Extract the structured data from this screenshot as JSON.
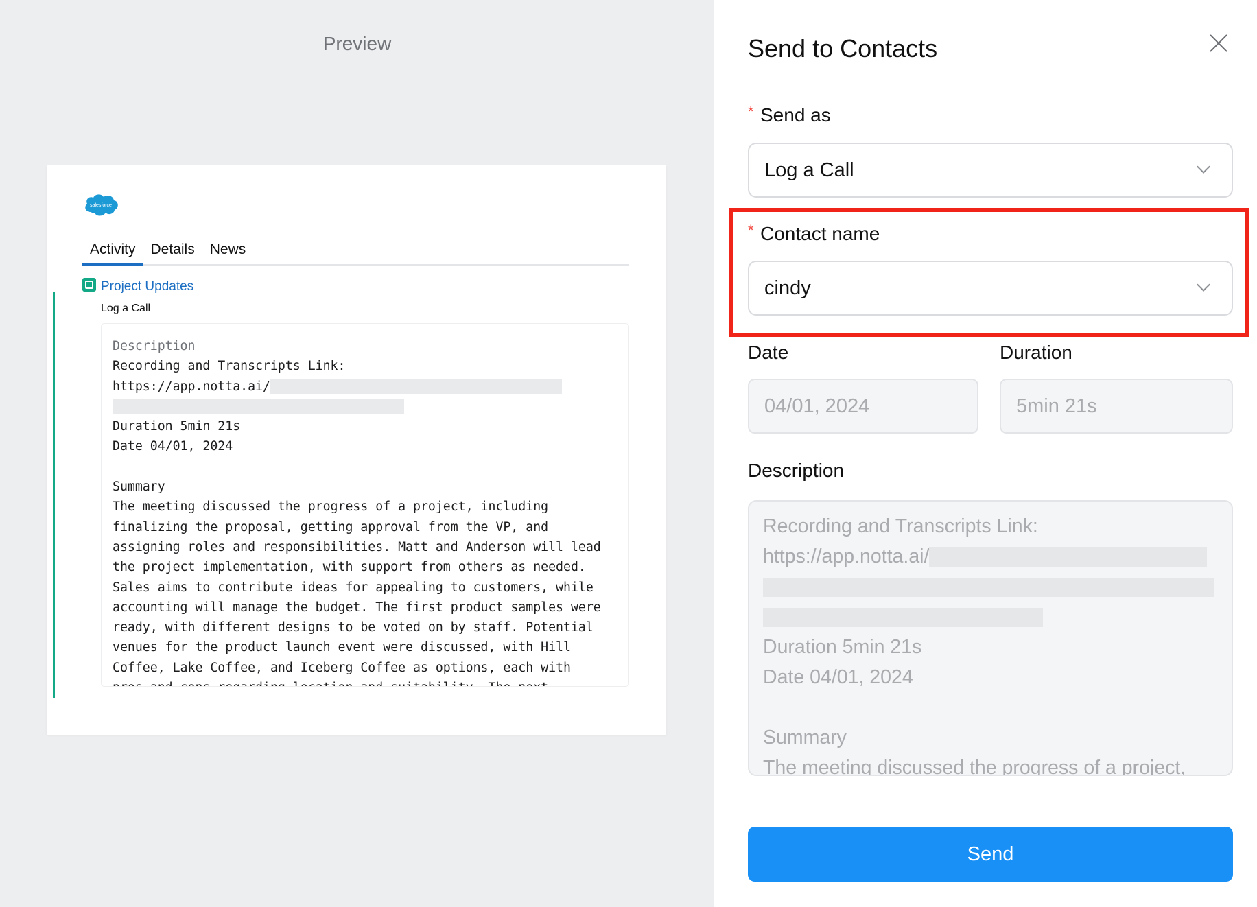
{
  "preview": {
    "title": "Preview",
    "tabs": [
      "Activity",
      "Details",
      "News"
    ],
    "activity": {
      "link": "Project Updates",
      "subtitle": "Log a Call",
      "description_label": "Description",
      "line1": "Recording and Transcripts Link:",
      "line2": "https://app.notta.ai/",
      "duration": "Duration 5min 21s",
      "date": "Date 04/01, 2024",
      "summary_label": "Summary",
      "summary": "The meeting discussed the progress of a project, including\nfinalizing the proposal, getting approval from the VP, and\nassigning roles and responsibilities. Matt and Anderson will lead\nthe project implementation, with support from others as needed.\nSales aims to contribute ideas for appealing to customers, while\naccounting will manage the budget. The first product samples were\nready, with different designs to be voted on by staff. Potential\nvenues for the product launch event were discussed, with Hill\nCoffee, Lake Coffee, and Iceberg Coffee as options, each with\npros and cons regarding location and suitability. The next"
    }
  },
  "panel": {
    "title": "Send to Contacts",
    "send_as": {
      "label": "Send as",
      "value": "Log a Call"
    },
    "contact": {
      "label": "Contact name",
      "value": "cindy"
    },
    "date": {
      "label": "Date",
      "value": "04/01, 2024"
    },
    "duration": {
      "label": "Duration",
      "value": "5min 21s"
    },
    "description": {
      "label": "Description",
      "line1": "Recording and Transcripts Link:",
      "line2": "https://app.notta.ai/",
      "duration": "Duration 5min 21s",
      "date": "Date 04/01, 2024",
      "summary_label": "Summary",
      "summary": "The meeting discussed the progress of a project,"
    },
    "send_label": "Send"
  },
  "colors": {
    "accent": "#1890f6",
    "highlight": "#f02418",
    "activity": "#14a986",
    "link": "#1b6ec2"
  }
}
